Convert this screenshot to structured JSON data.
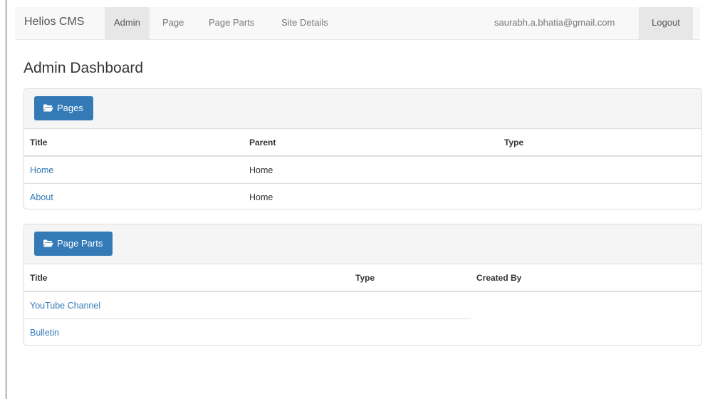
{
  "navbar": {
    "brand": "Helios CMS",
    "items": [
      {
        "label": "Admin",
        "active": true
      },
      {
        "label": "Page",
        "active": false
      },
      {
        "label": "Page Parts",
        "active": false
      },
      {
        "label": "Site Details",
        "active": false
      }
    ],
    "user_email": "saurabh.a.bhatia@gmail.com",
    "logout": "Logout"
  },
  "page_title": "Admin Dashboard",
  "pages_panel": {
    "button_label": "Pages",
    "button_icon": "folder-open-icon",
    "columns": [
      "Title",
      "Parent",
      "Type"
    ],
    "rows": [
      {
        "title": "Home",
        "parent": "Home",
        "type": ""
      },
      {
        "title": "About",
        "parent": "Home",
        "type": ""
      }
    ]
  },
  "page_parts_panel": {
    "button_label": "Page Parts",
    "button_icon": "folder-open-icon",
    "columns": [
      "Title",
      "Type",
      "Created By"
    ],
    "rows": [
      {
        "title": "YouTube Channel"
      },
      {
        "title": "Bulletin"
      }
    ]
  },
  "colors": {
    "primary": "#337ab7",
    "navbar_bg": "#f8f8f8",
    "active_nav_bg": "#e7e7e7",
    "link": "#337ab7"
  }
}
